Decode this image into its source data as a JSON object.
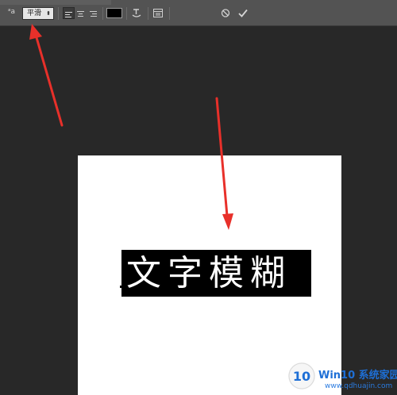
{
  "options_bar": {
    "text_orientation_icon": "text-orientation-icon",
    "font_size_glyph": "ᵃa",
    "antialias": {
      "value": "平滑",
      "options_arrow": "⬍"
    },
    "align_buttons": [
      "align-left-icon",
      "align-center-icon",
      "align-right-icon"
    ],
    "text_color": "#000000",
    "warp_text_icon": "warp-text-icon",
    "panels_icon": "character-panels-icon",
    "cancel_icon": "cancel-icon",
    "commit_icon": "commit-checkmark-icon"
  },
  "canvas": {
    "background": "#ffffff",
    "text_layer": {
      "content": "文字模糊",
      "highlight_color": "#000000",
      "text_color": "#ffffff"
    }
  },
  "annotations": {
    "arrow_color": "#e8302a"
  },
  "watermark": {
    "title": "Win10 系统家园",
    "url": "www.qdhuajin.com",
    "logo_text": "10"
  }
}
